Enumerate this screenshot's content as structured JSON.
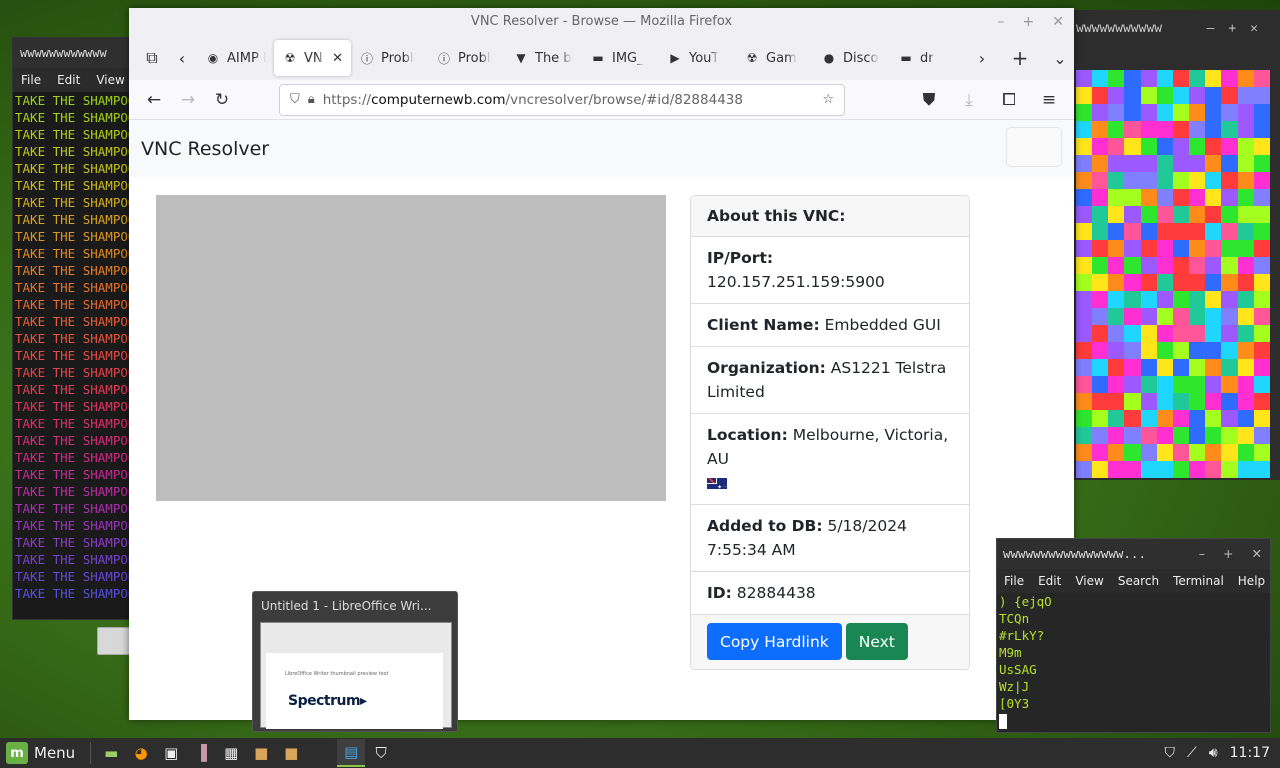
{
  "left_terminal": {
    "title": "wwwwwwwwwwww",
    "menu": [
      "File",
      "Edit",
      "View"
    ],
    "line_text": "TAKE THE SHAMPOO",
    "line_count": 30
  },
  "pixel_window": {
    "title": "wwwwwwwwwww",
    "palette": [
      "#ff3b3b",
      "#2fe62f",
      "#2f6bff",
      "#ff8c1a",
      "#ff2fd2",
      "#9b59ff",
      "#1fd6ff",
      "#ffe51a",
      "#a4ff1f",
      "#ff5599",
      "#20c997",
      "#7f7fff"
    ]
  },
  "browser": {
    "window_title": "VNC Resolver - Browse — Mozilla Firefox",
    "window_controls": [
      "–",
      "+",
      "✕"
    ],
    "tabs": [
      {
        "label": "AIMP Fre",
        "icon": "aimp-icon",
        "glyph": "◉"
      },
      {
        "label": "VNC",
        "icon": "vnc-icon",
        "glyph": "☢",
        "active": true
      },
      {
        "label": "Probl",
        "icon": "info-icon",
        "glyph": "ⓘ"
      },
      {
        "label": "Probl",
        "icon": "info-icon",
        "glyph": "ⓘ"
      },
      {
        "label": "The b",
        "icon": "brave-icon",
        "glyph": "▼"
      },
      {
        "label": "IMG_",
        "icon": "image-icon",
        "glyph": "▬"
      },
      {
        "label": "YouT",
        "icon": "youtube-icon",
        "glyph": "▶"
      },
      {
        "label": "Gam",
        "icon": "game-icon",
        "glyph": "☢"
      },
      {
        "label": "Disco",
        "icon": "discord-icon",
        "glyph": "●"
      },
      {
        "label": "dr",
        "icon": "image-icon",
        "glyph": "▬"
      }
    ],
    "url_prefix": "https://",
    "url_domain": "computernewb.com",
    "url_path": "/vncresolver/browse/#id/82884438"
  },
  "page": {
    "brand": "VNC Resolver",
    "card_title": "About this VNC:",
    "fields": [
      {
        "label": "IP/Port:",
        "value": "120.157.251.159:5900"
      },
      {
        "label": "Client Name:",
        "value": "Embedded GUI"
      },
      {
        "label": "Organization:",
        "value": "AS1221 Telstra Limited"
      },
      {
        "label": "Location:",
        "value": "Melbourne, Victoria, AU"
      },
      {
        "label": "Added to DB:",
        "value": "5/18/2024 7:55:34 AM"
      },
      {
        "label": "ID:",
        "value": "82884438"
      }
    ],
    "copy_button": "Copy Hardlink",
    "next_button": "Next"
  },
  "preview": {
    "title": "Untitled 1 - LibreOffice Wri...",
    "doc_tiny_text": "LibreOffice Writer thumbnail preview text",
    "doc_logo": "Spectrum▸"
  },
  "right_terminal": {
    "title": "wwwwwwwwwwwwwwww...",
    "menu": [
      "File",
      "Edit",
      "View",
      "Search",
      "Terminal",
      "Help"
    ],
    "lines": [
      ") {ejqO",
      "TCQn",
      "#rLkY?",
      "M9m",
      "UsSAG",
      "Wz|J",
      "[0Y3"
    ]
  },
  "taskbar": {
    "menu_label": "Menu",
    "clock": "11:17"
  }
}
